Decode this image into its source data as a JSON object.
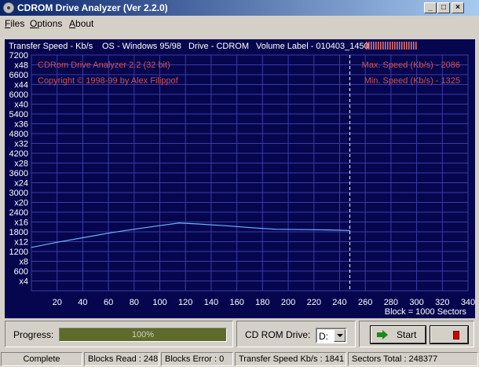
{
  "window": {
    "title": "CDROM Drive Analyzer (Ver 2.2.0)",
    "controls": [
      "_",
      "□",
      "×"
    ]
  },
  "menu": [
    "Files",
    "Options",
    "About"
  ],
  "header": {
    "axis_label": "Transfer Speed - Kb/s",
    "os": "OS - Windows 95/98",
    "drive": "Drive - CDROM",
    "volume": "Volume Label - 010403_1450"
  },
  "chart_info": {
    "title": "CDRom Drive Analyzer 2.2 (32 bit)",
    "copyright": "Copyright © 1998-99 by Alex Filippof",
    "max_speed": "Max. Speed (Kb/s) - 2086",
    "min_speed": "Min.  Speed (Kb/s) - 1325",
    "block_note": "Block = 1000 Sectors"
  },
  "chart_data": {
    "type": "line",
    "ylabel": "Transfer Speed - Kb/s",
    "ylim": [
      0,
      7200
    ],
    "xlim": [
      0,
      340
    ],
    "y_ticks": [
      "7200",
      "x48",
      "6600",
      "x44",
      "6000",
      "x40",
      "5400",
      "x36",
      "4800",
      "x32",
      "4200",
      "x28",
      "3600",
      "x24",
      "3000",
      "x20",
      "2400",
      "x16",
      "1800",
      "x12",
      "1200",
      "x8",
      "600",
      "x4"
    ],
    "x_ticks": [
      20,
      40,
      60,
      80,
      100,
      120,
      140,
      160,
      180,
      200,
      220,
      240,
      260,
      280,
      300,
      320,
      340
    ],
    "cursor_x": 248,
    "series": [
      {
        "color": "#6ab4ff",
        "x": [
          0,
          20,
          40,
          60,
          80,
          100,
          115,
          130,
          150,
          170,
          190,
          210,
          230,
          248
        ],
        "y": [
          1325,
          1480,
          1620,
          1760,
          1880,
          1990,
          2070,
          2040,
          1990,
          1930,
          1880,
          1870,
          1860,
          1841
        ]
      }
    ]
  },
  "progress": {
    "label": "Progress:",
    "value": 1.0,
    "text": "100%"
  },
  "drive_select": {
    "label": "CD ROM Drive:",
    "value": "D:"
  },
  "buttons": {
    "start": "Start"
  },
  "status": {
    "state": "Complete",
    "blocks_read": "Blocks Read : 248",
    "blocks_error": "Blocks Error : 0",
    "transfer_speed": "Transfer Speed Kb/s : 1841",
    "sectors_total": "Sectors Total : 248377"
  },
  "colors": {
    "chart_bg": "#06064e",
    "grid": "#3a3aa8",
    "label": "#d05050",
    "text_white": "#ffffff"
  }
}
